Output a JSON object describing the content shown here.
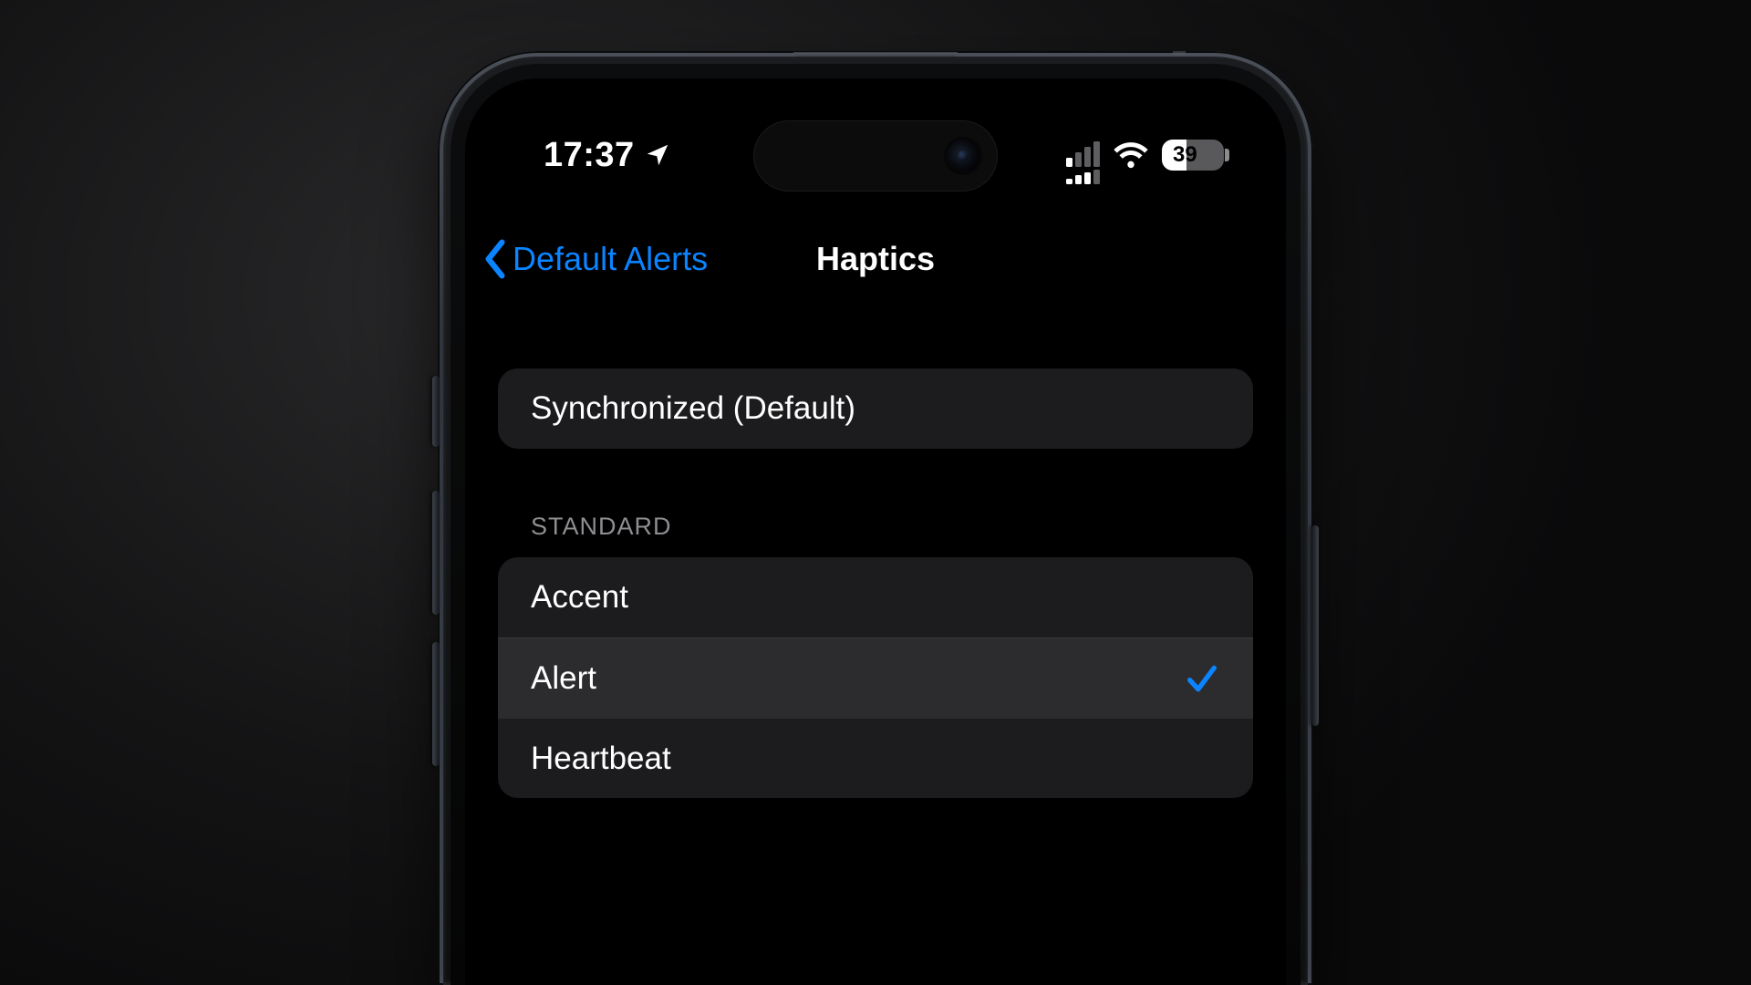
{
  "status": {
    "time": "17:37",
    "battery_percent": "39",
    "battery_fill_pct": 39
  },
  "nav": {
    "back_label": "Default Alerts",
    "title": "Haptics"
  },
  "default_group": {
    "option": "Synchronized (Default)"
  },
  "standard": {
    "header": "STANDARD",
    "items": [
      {
        "label": "Accent",
        "selected": false
      },
      {
        "label": "Alert",
        "selected": true
      },
      {
        "label": "Heartbeat",
        "selected": false
      }
    ]
  }
}
